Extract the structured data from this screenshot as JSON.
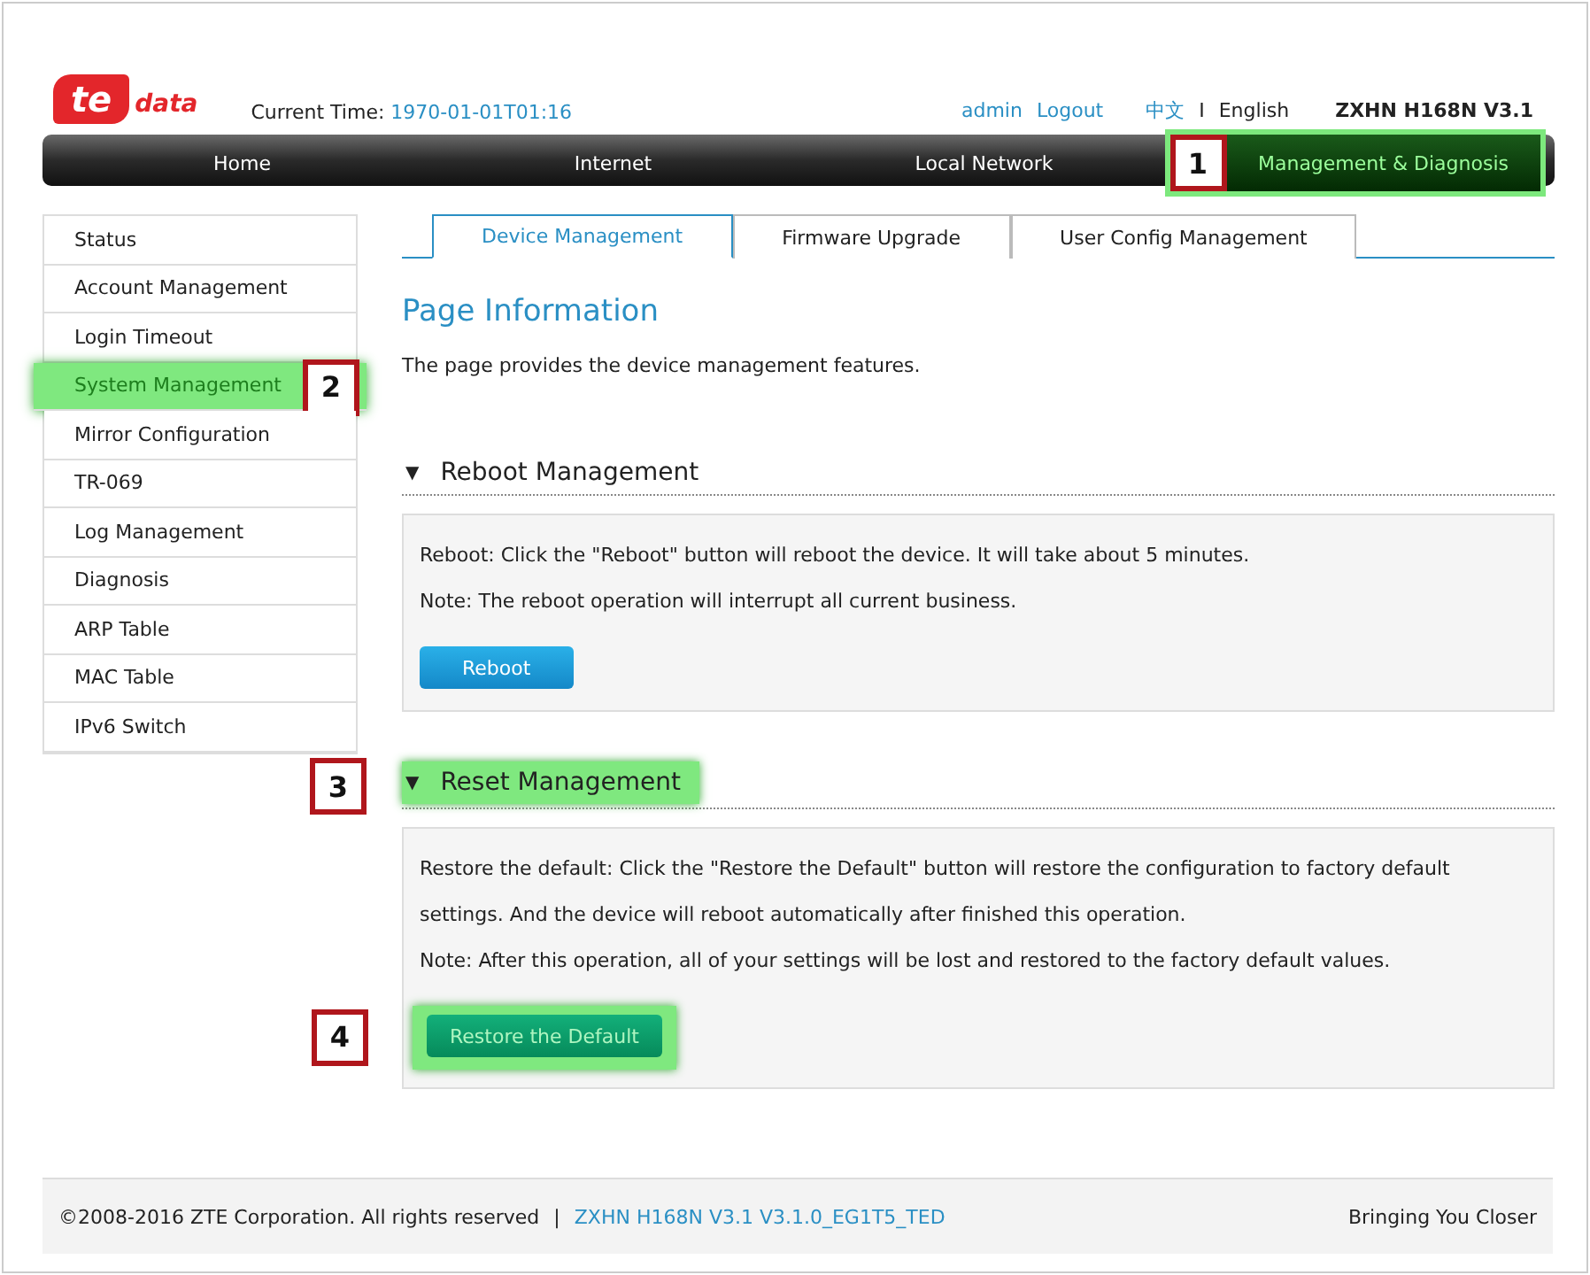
{
  "header": {
    "logo": {
      "mark": "te",
      "text": "data"
    },
    "time_label": "Current Time:",
    "time_value": "1970-01-01T01:16",
    "user": "admin",
    "logout": "Logout",
    "languages": [
      {
        "label": "中文",
        "selected": false
      },
      {
        "label": "English",
        "selected": true
      }
    ],
    "separator": "I",
    "model": "ZXHN H168N V3.1"
  },
  "nav": [
    {
      "label": "Home",
      "selected": false
    },
    {
      "label": "Internet",
      "selected": false
    },
    {
      "label": "Local Network",
      "selected": false
    },
    {
      "label": "Management & Diagnosis",
      "selected": true,
      "callout": "1"
    }
  ],
  "sidebar": {
    "items": [
      {
        "label": "Status",
        "selected": false
      },
      {
        "label": "Account Management",
        "selected": false
      },
      {
        "label": "Login Timeout",
        "selected": false
      },
      {
        "label": "System Management",
        "selected": true,
        "callout": "2"
      },
      {
        "label": "Mirror Configuration",
        "selected": false
      },
      {
        "label": "TR-069",
        "selected": false
      },
      {
        "label": "Log Management",
        "selected": false
      },
      {
        "label": "Diagnosis",
        "selected": false
      },
      {
        "label": "ARP Table",
        "selected": false
      },
      {
        "label": "MAC Table",
        "selected": false
      },
      {
        "label": "IPv6 Switch",
        "selected": false
      }
    ]
  },
  "tabs": [
    {
      "label": "Device Management",
      "selected": true
    },
    {
      "label": "Firmware Upgrade",
      "selected": false
    },
    {
      "label": "User Config Management",
      "selected": false
    }
  ],
  "page_title": "Page Information",
  "description": "The page provides the device management features.",
  "sections": [
    {
      "arrow": "▼",
      "title": "Reboot Management",
      "highlighted": false,
      "lines": [
        "Reboot: Click the \"Reboot\" button will reboot the device. It will take about 5 minutes.",
        "Note: The reboot operation will interrupt all current business."
      ],
      "button": {
        "label": "Reboot",
        "highlighted": false
      }
    },
    {
      "arrow": "▼",
      "title": "Reset Management",
      "highlighted": true,
      "callout": "3",
      "lines": [
        "Restore the default: Click the \"Restore the Default\" button will restore the configuration to factory default settings. And the device will reboot automatically after finished this operation.",
        "Note: After this operation, all of your settings will be lost and restored to the factory default values."
      ],
      "button": {
        "label": "Restore the Default",
        "highlighted": true,
        "callout": "4"
      }
    }
  ],
  "footer": {
    "copyright": "©2008-2016 ZTE Corporation. All rights reserved",
    "separator": "|",
    "version": "ZXHN H168N V3.1 V3.1.0_EG1T5_TED",
    "slogan": "Bringing You Closer"
  }
}
